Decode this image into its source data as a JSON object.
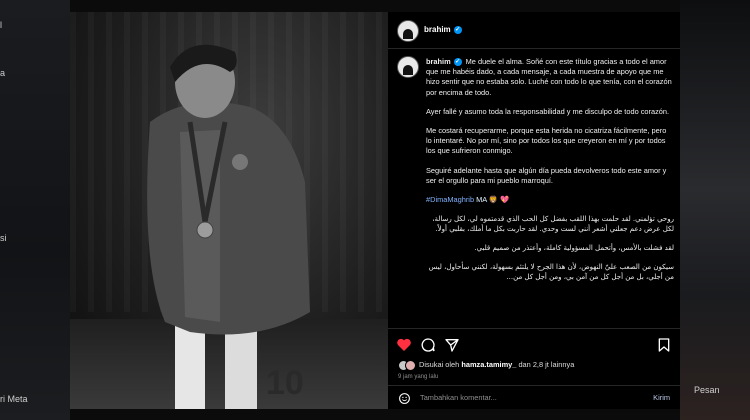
{
  "left_edge": {
    "labels": [
      "l",
      "a",
      "si",
      "ri Meta"
    ]
  },
  "right_edge": {
    "message_label": "Pesan"
  },
  "post": {
    "username": "brahim",
    "caption_paragraphs": [
      "Me duele el alma. Soñé con este título gracias a todo el amor que me habéis dado, a cada mensaje, a cada muestra de apoyo que me hizo sentir que no estaba solo. Luché con todo lo que tenía, con el corazón por encima de todo.",
      "Ayer fallé y asumo toda la responsabilidad y me disculpo de todo corazón.",
      "Me costará recuperarme, porque esta herida no cicatriza fácilmente, pero lo intentaré. No por mí, sino por todos los que creyeron en mí y por todos los que sufrieron conmigo.",
      "Seguiré adelante hasta que algún día pueda devolveros todo este amor y ser el orgullo para mi pueblo marroquí."
    ],
    "hashtag": "#DimaMaghrib",
    "hashtag_emoji": "MA 🦁 💖",
    "arabic_paragraphs": [
      "روحي تؤلمني. لقد حلمت بهذا اللقب بفضل كل الحب الذي قدمتموه لي، لكل رسالة، لكل عرض دعم جعلني أشعر أنني لست وحدي. لقد حاربت بكل ما أملك، بقلبي أولاً.",
      "لقد فشلت بالأمس، وأتحمل المسؤولية كاملة، وأعتذر من صميم قلبي.",
      "سيكون من الصعب عليّ النهوض، لأن هذا الجرح لا يلتئم بسهولة، لكنني سأحاول، ليس من أجلي، بل من أجل كل من آمن بي، ومن أجل كل من..."
    ],
    "liked_by_prefix": "Disukai oleh",
    "liked_by_user": "hamza.tamimy_",
    "liked_by_suffix": "dan 2,8 jt lainnya",
    "time_ago": "9 jam yang lalu",
    "comment_placeholder": "Tambahkan komentar...",
    "send_label": "Kirim",
    "photo_jersey_number": "10"
  },
  "icons": {
    "like": "heart-icon",
    "comment": "comment-icon",
    "share": "share-icon",
    "save": "bookmark-icon",
    "verified": "verified-badge-icon",
    "more": "more-options-icon",
    "emoji": "emoji-icon"
  },
  "colors": {
    "like": "#ff3040",
    "verified": "#0095f6",
    "hashtag": "#7fb2ff"
  }
}
